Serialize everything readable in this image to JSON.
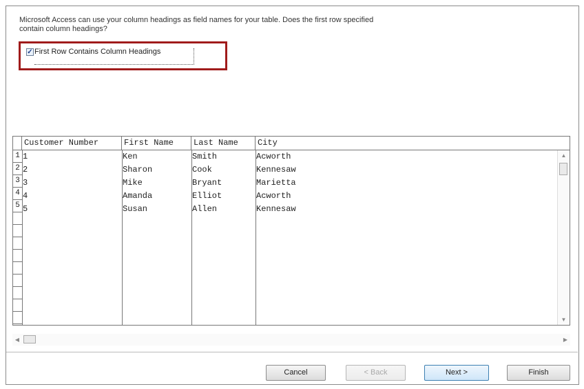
{
  "dialog": {
    "prompt": "Microsoft Access can use your column headings as field names for your table. Does the first row specified contain column headings?",
    "checkbox": {
      "label": "First Row Contains Column Headings",
      "checked": true
    }
  },
  "grid": {
    "headers": [
      "Customer Number",
      "First Name",
      "Last Name",
      "City"
    ],
    "row_numbers": [
      "1",
      "2",
      "3",
      "4",
      "5"
    ],
    "rows": [
      [
        "1",
        "Ken",
        "Smith",
        "Acworth"
      ],
      [
        "2",
        "Sharon",
        "Cook",
        "Kennesaw"
      ],
      [
        "3",
        "Mike",
        "Bryant",
        "Marietta"
      ],
      [
        "4",
        "Amanda",
        "Elliot",
        "Acworth"
      ],
      [
        "5",
        "Susan",
        "Allen",
        "Kennesaw"
      ]
    ]
  },
  "buttons": {
    "cancel": "Cancel",
    "back": "< Back",
    "next": "Next >",
    "finish": "Finish"
  },
  "colors": {
    "highlight": "#a01b1b",
    "primary_button": "#3c7fb1"
  }
}
